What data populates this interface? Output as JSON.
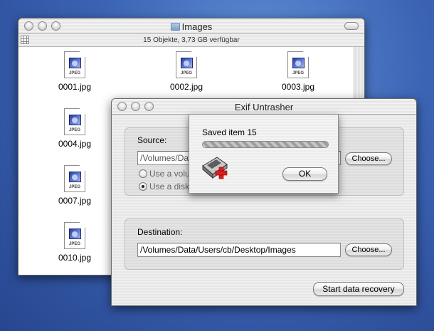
{
  "finder": {
    "title": "Images",
    "status": "15 Objekte, 3,73 GB verfügbar",
    "files": [
      "0001.jpg",
      "0002.jpg",
      "0003.jpg",
      "0004.jpg",
      "0007.jpg",
      "0010.jpg"
    ],
    "icon_label": "JPEG"
  },
  "exif": {
    "title": "Exif Untrasher",
    "source_label": "Source:",
    "source_path": "/Volumes/Data/Users/cb/Desktop/DigiCam Clone",
    "choose_label": "Choose...",
    "option_volume": "Use a volume as data source",
    "option_disk_image": "Use a disk image as data source",
    "destination_label": "Destination:",
    "destination_path": "/Volumes/Data/Users/cb/Desktop/Images",
    "start_label": "Start data recovery"
  },
  "sheet": {
    "message": "Saved item 15",
    "ok_label": "OK",
    "progress_fraction": 1.0
  },
  "colors": {
    "desktop": "#3c64b4",
    "icon_red": "#e21c1c"
  },
  "icons": [
    "folder-icon",
    "jpeg-icon",
    "view-icon",
    "app-icon"
  ]
}
